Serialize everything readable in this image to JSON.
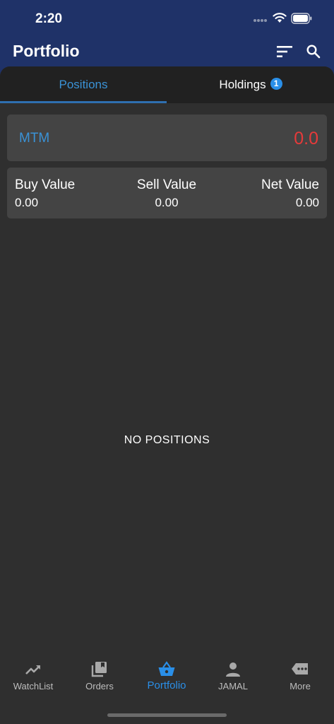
{
  "status_bar": {
    "time": "2:20"
  },
  "header": {
    "title": "Portfolio"
  },
  "tabs": {
    "positions_label": "Positions",
    "holdings_label": "Holdings",
    "holdings_badge": "1"
  },
  "mtm": {
    "label": "MTM",
    "value": "0.0"
  },
  "summary": {
    "buy_label": "Buy Value",
    "buy_value": "0.00",
    "sell_label": "Sell Value",
    "sell_value": "0.00",
    "net_label": "Net Value",
    "net_value": "0.00"
  },
  "empty_message": "NO POSITIONS",
  "nav": [
    {
      "label": "WatchList",
      "icon": "trending-up-icon"
    },
    {
      "label": "Orders",
      "icon": "library-books-icon"
    },
    {
      "label": "Portfolio",
      "icon": "basket-icon"
    },
    {
      "label": "JAMAL",
      "icon": "person-icon"
    },
    {
      "label": "More",
      "icon": "more-tag-icon"
    }
  ],
  "colors": {
    "header_bg": "#1f3268",
    "accent": "#2a8fe8",
    "negative": "#e63a3a",
    "card_bg": "#444444",
    "page_bg": "#2f2f2f"
  }
}
